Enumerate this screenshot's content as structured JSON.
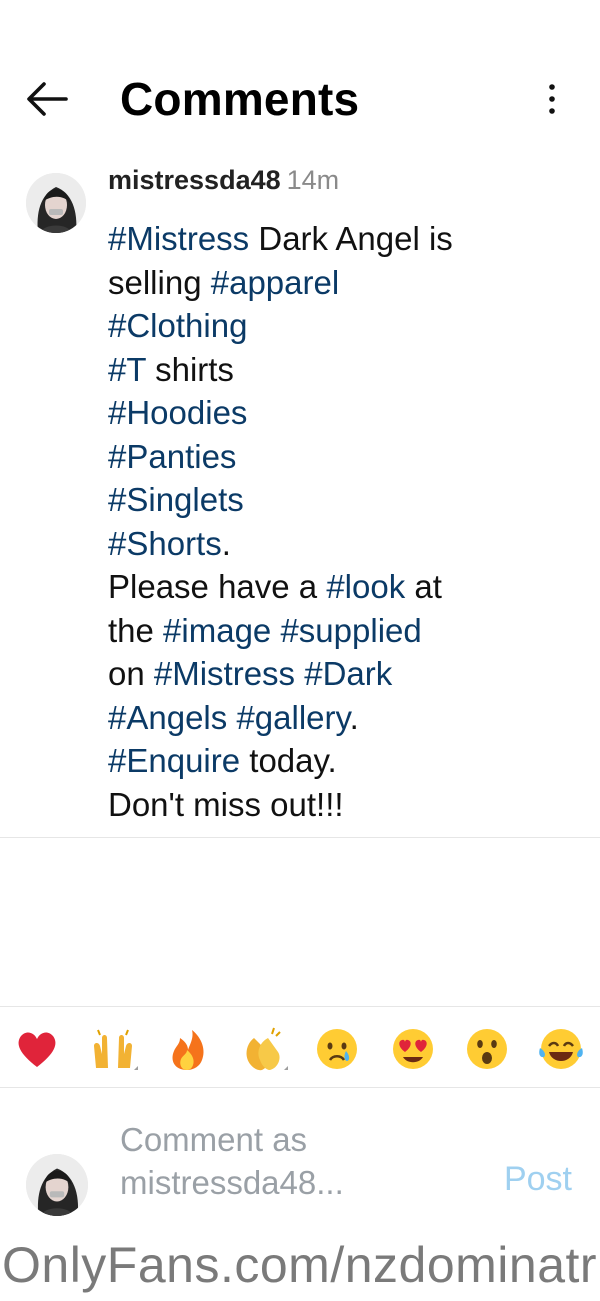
{
  "header": {
    "title": "Comments"
  },
  "comment": {
    "username": "mistressda48",
    "time": "14m",
    "lines": [
      [
        {
          "t": "#Mistress",
          "tag": true
        },
        {
          "t": " Dark Angel is",
          "tag": false
        }
      ],
      [
        {
          "t": "selling ",
          "tag": false
        },
        {
          "t": "#apparel",
          "tag": true
        }
      ],
      [
        {
          "t": "#Clothing",
          "tag": true
        }
      ],
      [
        {
          "t": "#T",
          "tag": true
        },
        {
          "t": " shirts",
          "tag": false
        }
      ],
      [
        {
          "t": "#Hoodies",
          "tag": true
        }
      ],
      [
        {
          "t": "#Panties",
          "tag": true
        }
      ],
      [
        {
          "t": "#Singlets",
          "tag": true
        }
      ],
      [
        {
          "t": "#Shorts",
          "tag": true
        },
        {
          "t": ".",
          "tag": false
        }
      ],
      [
        {
          "t": "Please have a ",
          "tag": false
        },
        {
          "t": "#look",
          "tag": true
        },
        {
          "t": " at",
          "tag": false
        }
      ],
      [
        {
          "t": "the ",
          "tag": false
        },
        {
          "t": "#image",
          "tag": true
        },
        {
          "t": " ",
          "tag": false
        },
        {
          "t": "#supplied",
          "tag": true
        }
      ],
      [
        {
          "t": "on ",
          "tag": false
        },
        {
          "t": "#Mistress",
          "tag": true
        },
        {
          "t": " ",
          "tag": false
        },
        {
          "t": "#Dark",
          "tag": true
        }
      ],
      [
        {
          "t": "#Angels",
          "tag": true
        },
        {
          "t": " ",
          "tag": false
        },
        {
          "t": "#gallery",
          "tag": true
        },
        {
          "t": ".",
          "tag": false
        }
      ],
      [
        {
          "t": "#Enquire",
          "tag": true
        },
        {
          "t": " today.",
          "tag": false
        }
      ],
      [
        {
          "t": "Don't miss out!!!",
          "tag": false
        }
      ]
    ]
  },
  "reactions": [
    {
      "name": "heart-emoji",
      "glyph": "❤️"
    },
    {
      "name": "raising-hands-emoji",
      "glyph": "🙌"
    },
    {
      "name": "fire-emoji",
      "glyph": "🔥"
    },
    {
      "name": "clapping-hands-emoji",
      "glyph": "👏"
    },
    {
      "name": "crying-face-emoji",
      "glyph": "😢"
    },
    {
      "name": "heart-eyes-emoji",
      "glyph": "😍"
    },
    {
      "name": "surprised-face-emoji",
      "glyph": "😮"
    },
    {
      "name": "tears-of-joy-emoji",
      "glyph": "😂"
    }
  ],
  "composer": {
    "placeholder_line1": "Comment as",
    "placeholder_line2": "mistressda48...",
    "post_label": "Post"
  },
  "watermark": "OnlyFans.com/nzdominatr",
  "colors": {
    "hashtag": "#0b3a66",
    "post_disabled": "#9fd0f0",
    "meta_gray": "#8a8a8a"
  }
}
